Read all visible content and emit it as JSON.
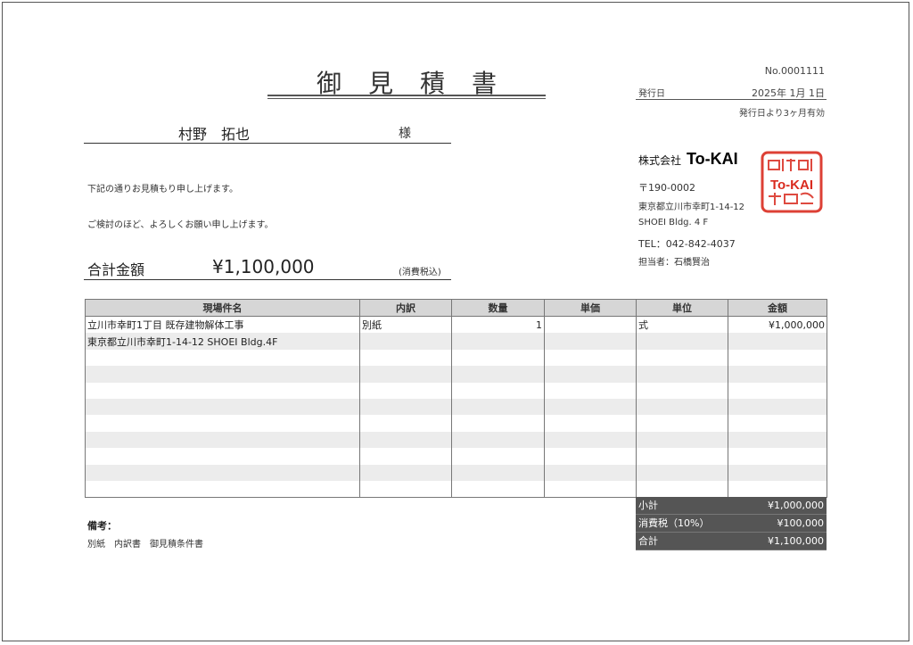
{
  "header": {
    "title": "御見積書",
    "doc_no": "No.0001111",
    "issue_label": "発行日",
    "issue_date": "2025年 1月 1日",
    "validity": "発行日より3ヶ月有効"
  },
  "client": {
    "name": "村野　拓也",
    "honorific": "様"
  },
  "greeting": {
    "line1": "下記の通りお見積もり申し上げます。",
    "line2": "ご検討のほど、よろしくお願い申し上げます。"
  },
  "total": {
    "label": "合計金額",
    "value": "¥1,100,000",
    "note": "(消費税込)"
  },
  "company": {
    "prefix": "株式会社",
    "name": "To-KAI",
    "zip": "〒190-0002",
    "address": "東京都立川市幸町1-14-12",
    "building": "SHOEI Bldg. 4 F",
    "tel": "TEL：042-842-4037",
    "rep": "担当者：石橋賢治",
    "stamp_text": "To-KAI",
    "stamp_color": "#d92b1f"
  },
  "table": {
    "headers": [
      "現場件名",
      "内訳",
      "数量",
      "単価",
      "単位",
      "金額"
    ],
    "rows": [
      [
        "立川市幸町1丁目 既存建物解体工事",
        "別紙",
        "1",
        "",
        "式",
        "¥1,000,000"
      ],
      [
        "東京都立川市幸町1-14-12 SHOEI Bldg.4F",
        "",
        "",
        "",
        "",
        ""
      ],
      [
        "",
        "",
        "",
        "",
        "",
        ""
      ],
      [
        "",
        "",
        "",
        "",
        "",
        ""
      ],
      [
        "",
        "",
        "",
        "",
        "",
        ""
      ],
      [
        "",
        "",
        "",
        "",
        "",
        ""
      ],
      [
        "",
        "",
        "",
        "",
        "",
        ""
      ],
      [
        "",
        "",
        "",
        "",
        "",
        ""
      ],
      [
        "",
        "",
        "",
        "",
        "",
        ""
      ],
      [
        "",
        "",
        "",
        "",
        "",
        ""
      ],
      [
        "",
        "",
        "",
        "",
        "",
        ""
      ]
    ]
  },
  "summary": {
    "subtotal_label": "小計",
    "subtotal_value": "¥1,000,000",
    "tax_label": "消費税（10%）",
    "tax_value": "¥100,000",
    "total_label": "合計",
    "total_value": "¥1,100,000"
  },
  "remarks": {
    "label": "備考：",
    "text": "別紙　内訳書　御見積条件書"
  }
}
